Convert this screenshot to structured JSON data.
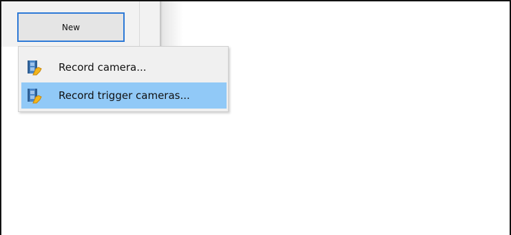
{
  "toolbar": {
    "new_label": "New"
  },
  "menu": {
    "items": [
      {
        "label": "Record camera...",
        "icon": "record-camera-icon",
        "highlighted": false
      },
      {
        "label": "Record trigger cameras...",
        "icon": "record-trigger-icon",
        "highlighted": true
      }
    ]
  },
  "colors": {
    "highlight": "#91c9f7",
    "button_border": "#2b78d6"
  }
}
